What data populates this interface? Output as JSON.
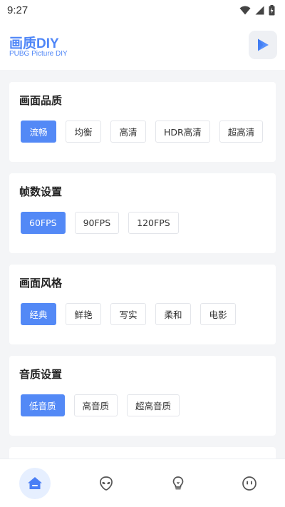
{
  "status": {
    "time": "9:27"
  },
  "header": {
    "title": "画质DIY",
    "subtitle": "PUBG Picture DIY"
  },
  "sections": [
    {
      "title": "画面品质",
      "options": [
        "流畅",
        "均衡",
        "高清",
        "HDR高清",
        "超高清"
      ],
      "selected": "流畅"
    },
    {
      "title": "帧数设置",
      "options": [
        "60FPS",
        "90FPS",
        "120FPS"
      ],
      "selected": "60FPS"
    },
    {
      "title": "画面风格",
      "options": [
        "经典",
        "鲜艳",
        "写实",
        "柔和",
        "电影"
      ],
      "selected": "经典"
    },
    {
      "title": "音质设置",
      "options": [
        "低音质",
        "高音质",
        "超高音质"
      ],
      "selected": "低音质"
    }
  ],
  "bottom_nav": {
    "items": [
      {
        "icon": "home-icon",
        "active": true
      },
      {
        "icon": "alien-icon",
        "active": false
      },
      {
        "icon": "lightbulb-icon",
        "active": false
      },
      {
        "icon": "face-icon",
        "active": false
      }
    ]
  },
  "colors": {
    "accent": "#5389f6",
    "title_blue": "#4f86f7",
    "background": "#f4f5f7"
  }
}
